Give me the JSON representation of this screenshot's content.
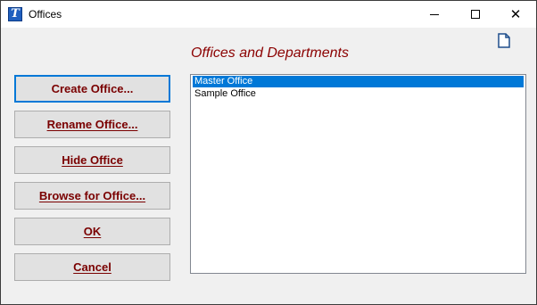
{
  "window": {
    "title": "Offices",
    "app_icon_letter": "T",
    "controls": [
      "minimize",
      "maximize",
      "close"
    ]
  },
  "heading": "Offices and Departments",
  "icons": {
    "app": "app-icon",
    "new_document": "document-icon"
  },
  "buttons": {
    "create": "Create Office...",
    "rename": "Rename Office...",
    "hide": "Hide Office",
    "browse": "Browse for Office...",
    "ok": "OK",
    "cancel": "Cancel"
  },
  "offices": {
    "items": [
      {
        "label": "Master Office",
        "selected": true
      },
      {
        "label": "Sample Office",
        "selected": false
      }
    ]
  },
  "colors": {
    "heading": "#8b0000",
    "button_text": "#7a0000",
    "selection": "#0078d7"
  }
}
